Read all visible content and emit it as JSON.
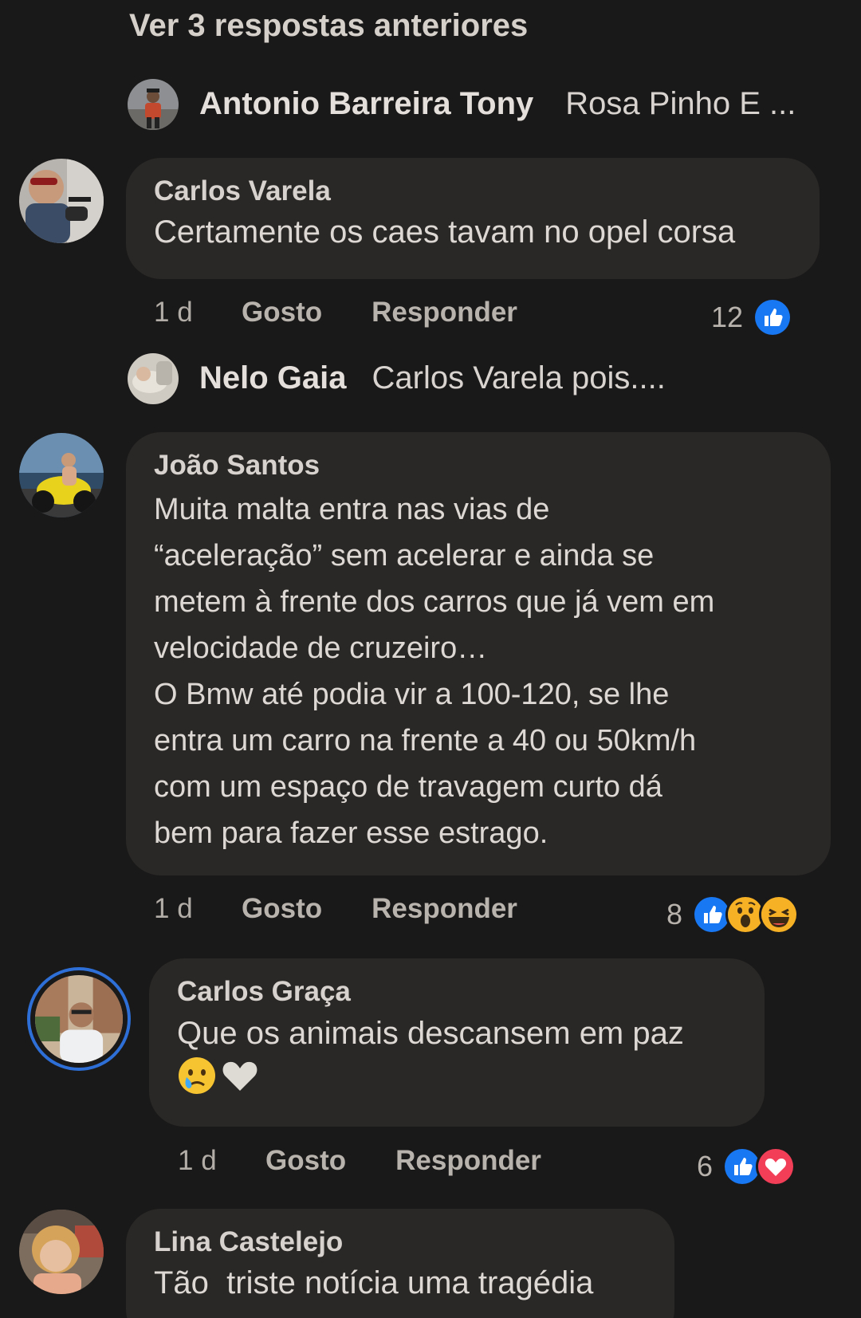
{
  "view_previous_label": "Ver 3 respostas anteriores",
  "replies": [
    {
      "name": "Antonio Barreira Tony",
      "text": "Rosa Pinho E ..."
    },
    {
      "name": "Nelo Gaia",
      "text": "Carlos Varela pois...."
    }
  ],
  "comments": [
    {
      "author": "Carlos Varela",
      "text": "Certamente os caes tavam no opel corsa",
      "time": "1 d",
      "like_label": "Gosto",
      "reply_label": "Responder",
      "reaction_count": "12",
      "reactions": [
        "like-icon"
      ]
    },
    {
      "author": "João Santos",
      "text": "Muita malta entra nas vias de\n“aceleração” sem acelerar e ainda se\nmetem à frente dos carros que já vem em\nvelocidade de cruzeiro…\nO Bmw até podia vir a 100-120, se lhe\nentra um carro na frente a 40 ou 50km/h\ncom um espaço de travagem curto dá\nbem para fazer esse estrago.",
      "time": "1 d",
      "like_label": "Gosto",
      "reply_label": "Responder",
      "reaction_count": "8",
      "reactions": [
        "like-icon",
        "wow-icon",
        "haha-icon"
      ]
    },
    {
      "author": "Carlos Graça",
      "text": "Que os animais descansem em paz",
      "emojis": [
        "crying-face-emoji",
        "white-heart-emoji"
      ],
      "time": "1 d",
      "like_label": "Gosto",
      "reply_label": "Responder",
      "reaction_count": "6",
      "reactions": [
        "like-icon",
        "love-icon"
      ]
    },
    {
      "author": "Lina Castelejo",
      "text": "Tão  triste notícia uma tragédia"
    }
  ],
  "colors": {
    "background": "#1a1919",
    "bubble": "#2a2826",
    "like_blue": "#1877f2",
    "love_red": "#f33e58",
    "story_ring": "#2d6fd6"
  }
}
